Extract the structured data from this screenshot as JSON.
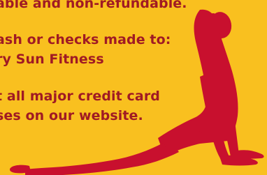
{
  "colors": {
    "background": "#f9c01f",
    "text": "#a01a24",
    "figure": "#c8102e"
  },
  "text_lines": [
    "able and non-refundable.",
    "ash or checks made to:",
    "ry Sun Fitness",
    "t all major credit card",
    "ses on our website."
  ],
  "figure_icon": "yoga-cobra-pose-silhouette"
}
